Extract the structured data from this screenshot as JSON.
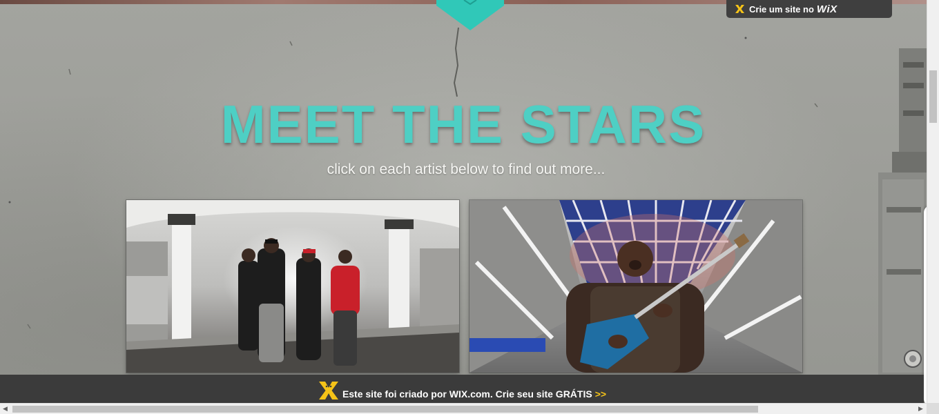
{
  "header": {
    "wix_badge_text": "Crie um site no",
    "wix_badge_brand": "WiX",
    "wix_icon": "wix-x-icon",
    "scroll_down_icon": "chevron-down-icon"
  },
  "main": {
    "title": "MEET THE STARS",
    "subtitle": "click on each artist below to find out more...",
    "cards": [
      {
        "image": "group-photo-subway-platform"
      },
      {
        "image": "guitarist-subway-station"
      }
    ]
  },
  "footer": {
    "banner_text": "Este site foi criado por WIX.com. Crie seu site GRÁTIS",
    "banner_arrows": ">>"
  },
  "side_panel": {
    "icon": "triangle-left-icon"
  },
  "colors": {
    "accent": "#4ecfc4",
    "wix_bar": "#3b3b3b",
    "wix_yellow": "#f5c318",
    "side_arrow": "#29a8e0"
  }
}
